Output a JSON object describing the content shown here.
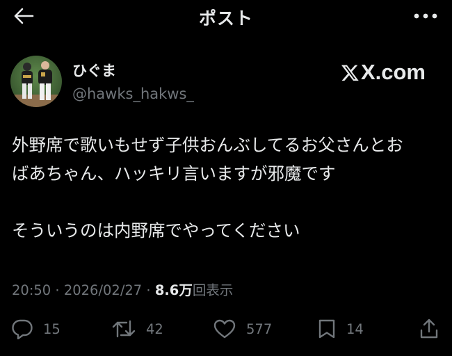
{
  "header": {
    "title": "ポスト",
    "back_icon": "arrow-left-icon",
    "more_icon": "more-horizontal-icon"
  },
  "author": {
    "display_name": "ひぐま",
    "handle": "@hawks_hakws_",
    "avatar_icon": "avatar-photo"
  },
  "watermark": {
    "text": "X.com",
    "icon": "x-logo-icon"
  },
  "post": {
    "lines": [
      "外野席で歌いもせず子供おんぶしてるお父さんとお",
      "ばあちゃん、ハッキリ言いますが邪魔です",
      "そういうのは内野席でやってください"
    ]
  },
  "meta": {
    "time": "20:50",
    "separator": "·",
    "date": "2026/02/27",
    "views_count": "8.6万",
    "views_label": "回表示"
  },
  "actions": {
    "reply": {
      "icon": "reply-icon",
      "count": "15"
    },
    "repost": {
      "icon": "repost-icon",
      "count": "42"
    },
    "like": {
      "icon": "heart-icon",
      "count": "577"
    },
    "bookmark": {
      "icon": "bookmark-icon",
      "count": "14"
    },
    "share": {
      "icon": "share-icon"
    }
  },
  "colors": {
    "background": "#000000",
    "text_primary": "#e7e9ea",
    "text_secondary": "#71767b"
  }
}
